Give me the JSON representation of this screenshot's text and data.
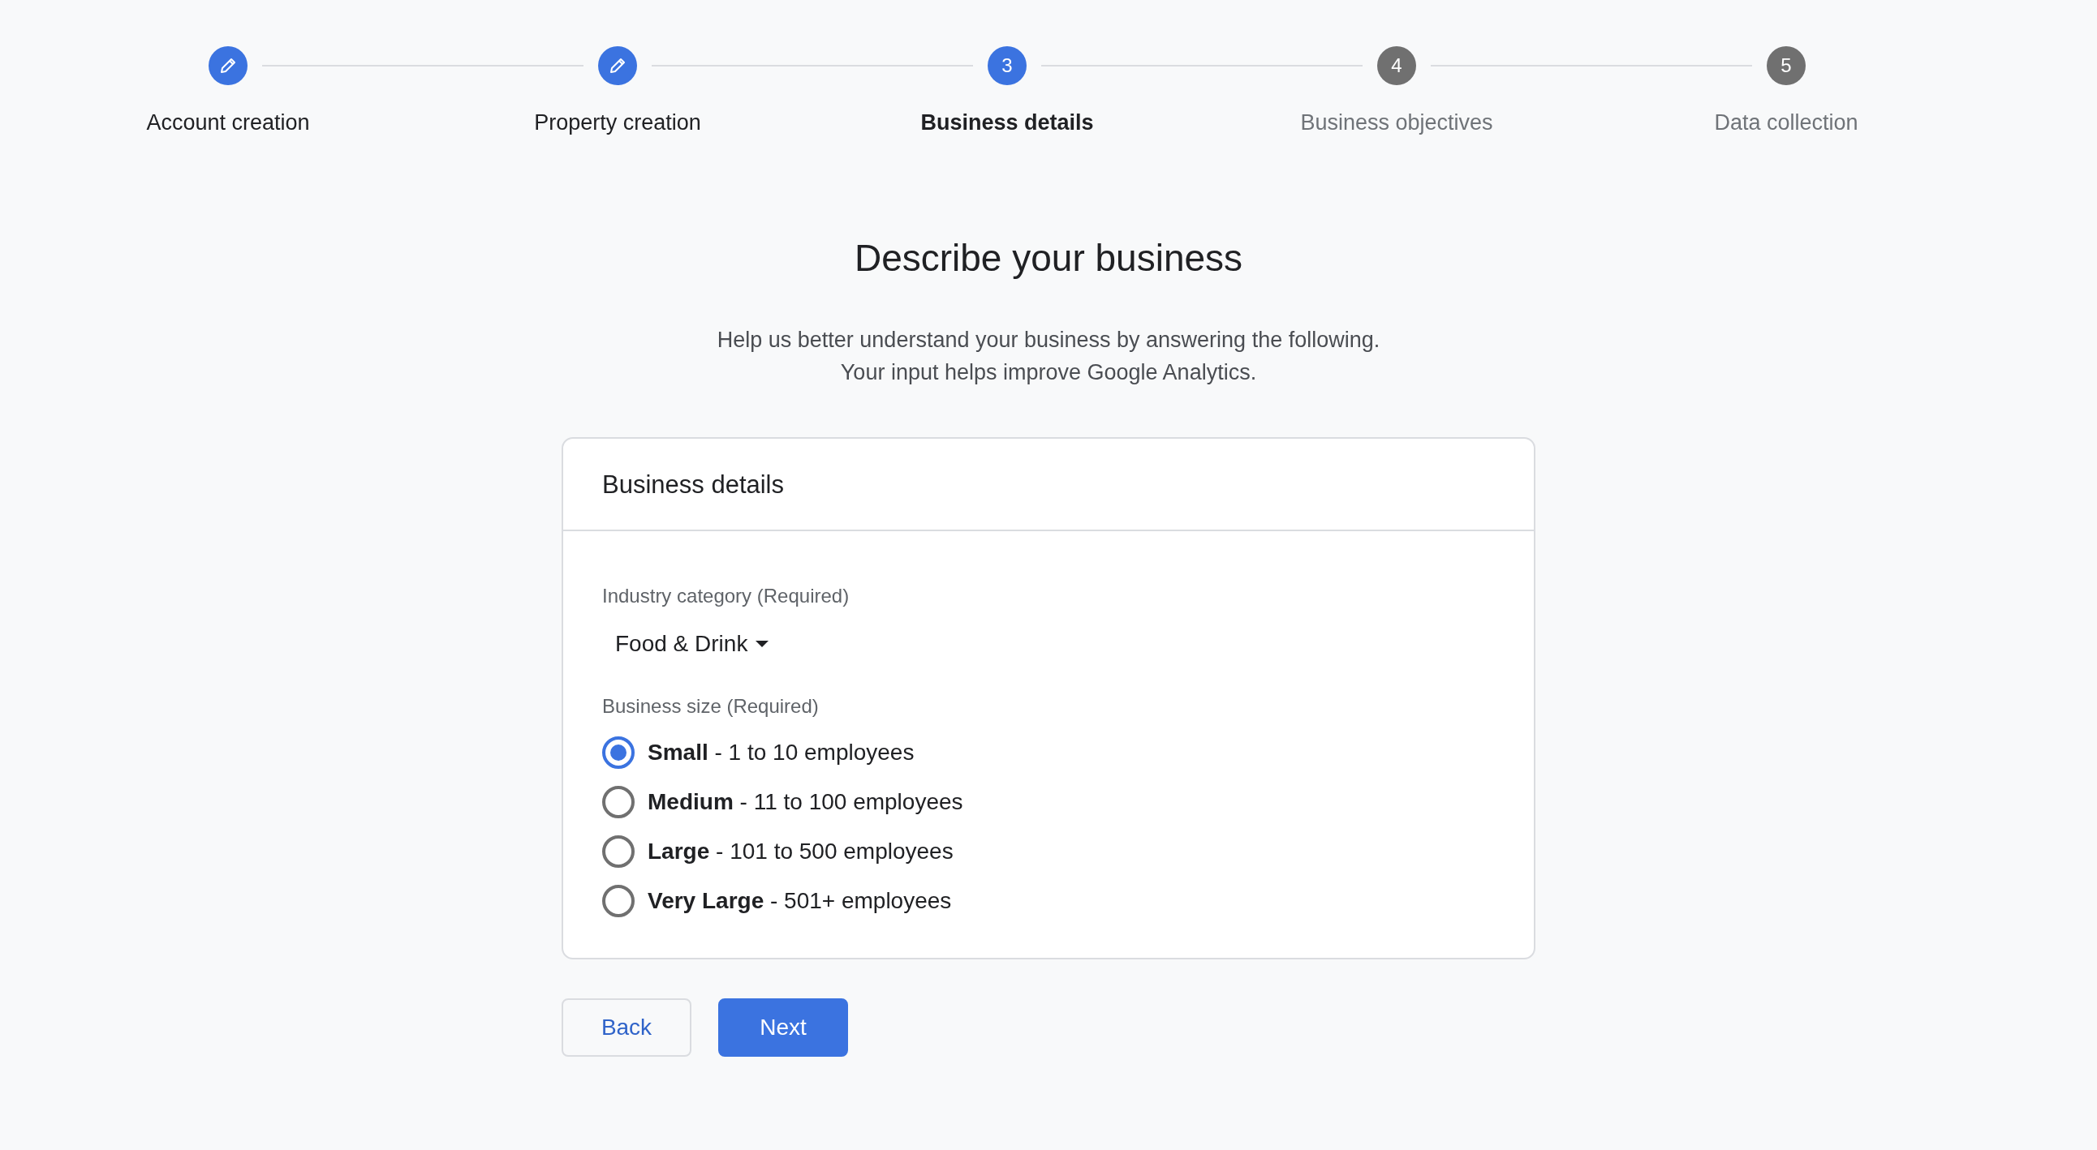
{
  "steps": [
    {
      "label": "Account creation",
      "completed": true,
      "selected": false
    },
    {
      "label": "Property creation",
      "completed": true,
      "selected": false
    },
    {
      "label": "Business details",
      "number": "3",
      "completed": false,
      "selected": true
    },
    {
      "label": "Business objectives",
      "number": "4",
      "completed": false,
      "selected": false
    },
    {
      "label": "Data collection",
      "number": "5",
      "completed": false,
      "selected": false
    }
  ],
  "heading": "Describe your business",
  "intro": [
    "Help us better understand your business by answering the following.",
    "Your input helps improve Google Analytics."
  ],
  "card": {
    "title": "Business details",
    "industry": {
      "label": "Industry category (Required)",
      "value": "Food & Drink"
    },
    "size": {
      "label": "Business size (Required)",
      "options": [
        {
          "label": "**Small** - 1 to 10 employees",
          "selected": true
        },
        {
          "label": "**Medium** - 11 to 100 employees",
          "selected": false
        },
        {
          "label": "**Large** - 101 to 500 employees",
          "selected": false
        },
        {
          "label": "**Very Large** - 501+ employees",
          "selected": false
        }
      ]
    }
  },
  "buttons": [
    {
      "label": "Back",
      "kind": "secondary"
    },
    {
      "label": "Next",
      "kind": "primary"
    }
  ]
}
